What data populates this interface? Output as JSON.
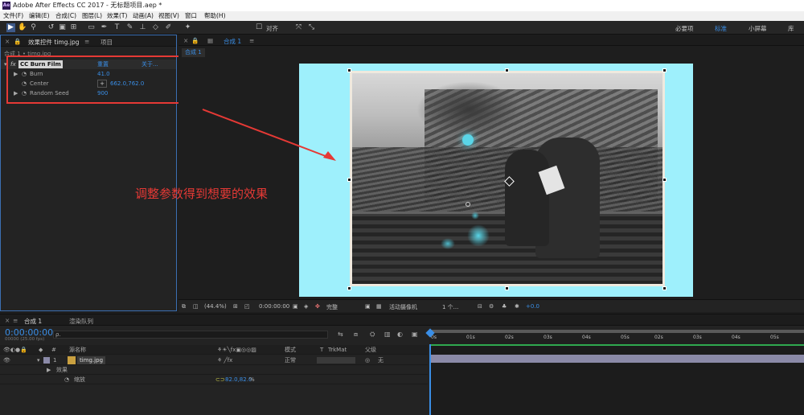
{
  "app": {
    "title": "Adobe After Effects CC 2017 - 无标题项目.aep *",
    "logo_text": "Ae"
  },
  "menu": [
    "文件(F)",
    "编辑(E)",
    "合成(C)",
    "图层(L)",
    "效果(T)",
    "动画(A)",
    "视图(V)",
    "窗口",
    "帮助(H)"
  ],
  "toolbar": {
    "snap_label": "对齐",
    "workspaces": [
      "必要项",
      "标准",
      "小屏幕",
      "库"
    ],
    "active_workspace": "标准"
  },
  "effects_panel": {
    "tab_label": "效果控件 timg.jpg",
    "project_tab": "项目",
    "breadcrumb": "合成 1 • timg.jpg",
    "effect_name": "CC Burn Film",
    "reset_label": "重置",
    "about_label": "关于...",
    "params": [
      {
        "name": "Burn",
        "value": "41.0"
      },
      {
        "name": "Center",
        "value": "662.0,762.0"
      },
      {
        "name": "Random Seed",
        "value": "900"
      }
    ]
  },
  "viewer": {
    "tab_label": "合成 1",
    "sub_tab": "合成 1",
    "zoom": "(44.4%)",
    "timecode": "0:00:00:00",
    "resolution": "完整",
    "camera": "活动摄像机",
    "views": "1 个...",
    "exposure": "+0.0"
  },
  "annotation": "调整参数得到想要的效果",
  "timeline": {
    "tab_label": "合成 1",
    "render_queue": "渲染队列",
    "timecode": "0:00:00:00",
    "frame_info": "00000 (25.00 fps)",
    "search_placeholder": "ρ.",
    "columns": {
      "num": "#",
      "source": "源名称",
      "mode": "模式",
      "trkmat": "TrkMat",
      "parent": "父级"
    },
    "layers": [
      {
        "num": "1",
        "name": "timg.jpg",
        "mode": "正常",
        "parent": "无"
      }
    ],
    "effects_label": "效果",
    "scale_label": "缩放",
    "scale_value": "82.0,82.0",
    "scale_unit": "%",
    "ruler_ticks": [
      "0s",
      "01s",
      "02s",
      "03s",
      "04s",
      "05s",
      "02s",
      "03s",
      "04s",
      "05s"
    ]
  },
  "colors": {
    "accent": "#3a8ee6",
    "canvas_bg": "#9ef0fc",
    "annotation": "#e53935",
    "layer_bar": "#8b8aa8"
  }
}
